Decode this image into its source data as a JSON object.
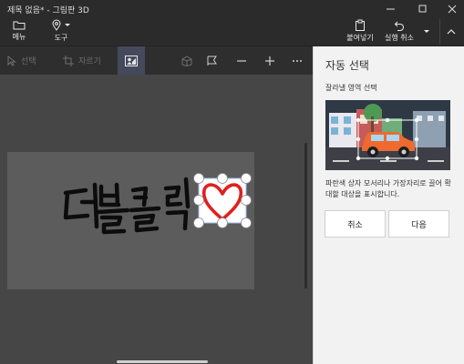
{
  "window": {
    "title": "제목 없음* - 그림판 3D",
    "minimize_icon": "minimize-icon",
    "maximize_icon": "maximize-icon",
    "close_icon": "close-icon"
  },
  "ribbon": {
    "menu_label": "메뉴",
    "tools_label": "도구",
    "paste_label": "붙여넣기",
    "undo_label": "실행 취소"
  },
  "toolbar": {
    "select_label": "선택",
    "crop_label": "자르기"
  },
  "panel": {
    "title": "자동 선택",
    "subtitle": "잘라낼 영역 선택",
    "description": "파란색 상자 모서리나 가장자리로 끌어 확대할 대상을 표시합니다.",
    "cancel_label": "취소",
    "next_label": "다음"
  },
  "canvas": {
    "drawing_text": "더블클릭"
  },
  "colors": {
    "title_bar": "#2b2b2b",
    "toolbar_active": "#44495c",
    "panel_bg": "#f2f2f2",
    "heart": "#e02020",
    "title_accent": "#0078d7"
  }
}
